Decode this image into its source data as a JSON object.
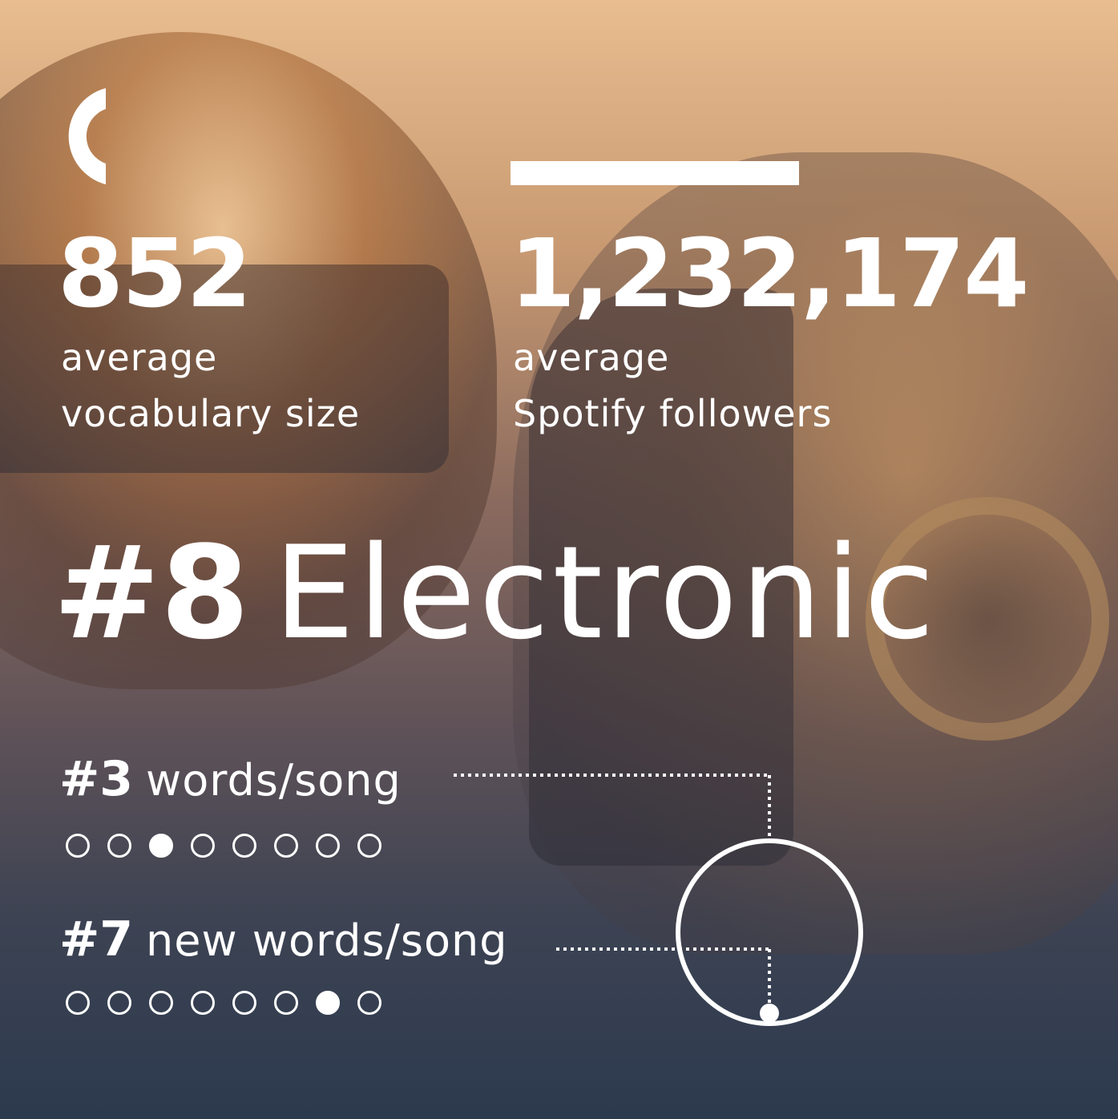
{
  "stats": {
    "vocabulary": {
      "value": "852",
      "line1": "average",
      "line2": "vocabulary size"
    },
    "followers": {
      "value": "1,232,174",
      "line1": "average",
      "line2": "Spotify followers"
    }
  },
  "genre": {
    "rank": "#8",
    "name": "Electronic"
  },
  "metrics": [
    {
      "rank": "#3",
      "label": "words/song",
      "position": 3,
      "total": 8
    },
    {
      "rank": "#7",
      "label": "new words/song",
      "position": 7,
      "total": 8
    }
  ],
  "colors": {
    "text": "#ffffff",
    "top": "#e8bd8f",
    "bottom": "#2c3a4e"
  }
}
